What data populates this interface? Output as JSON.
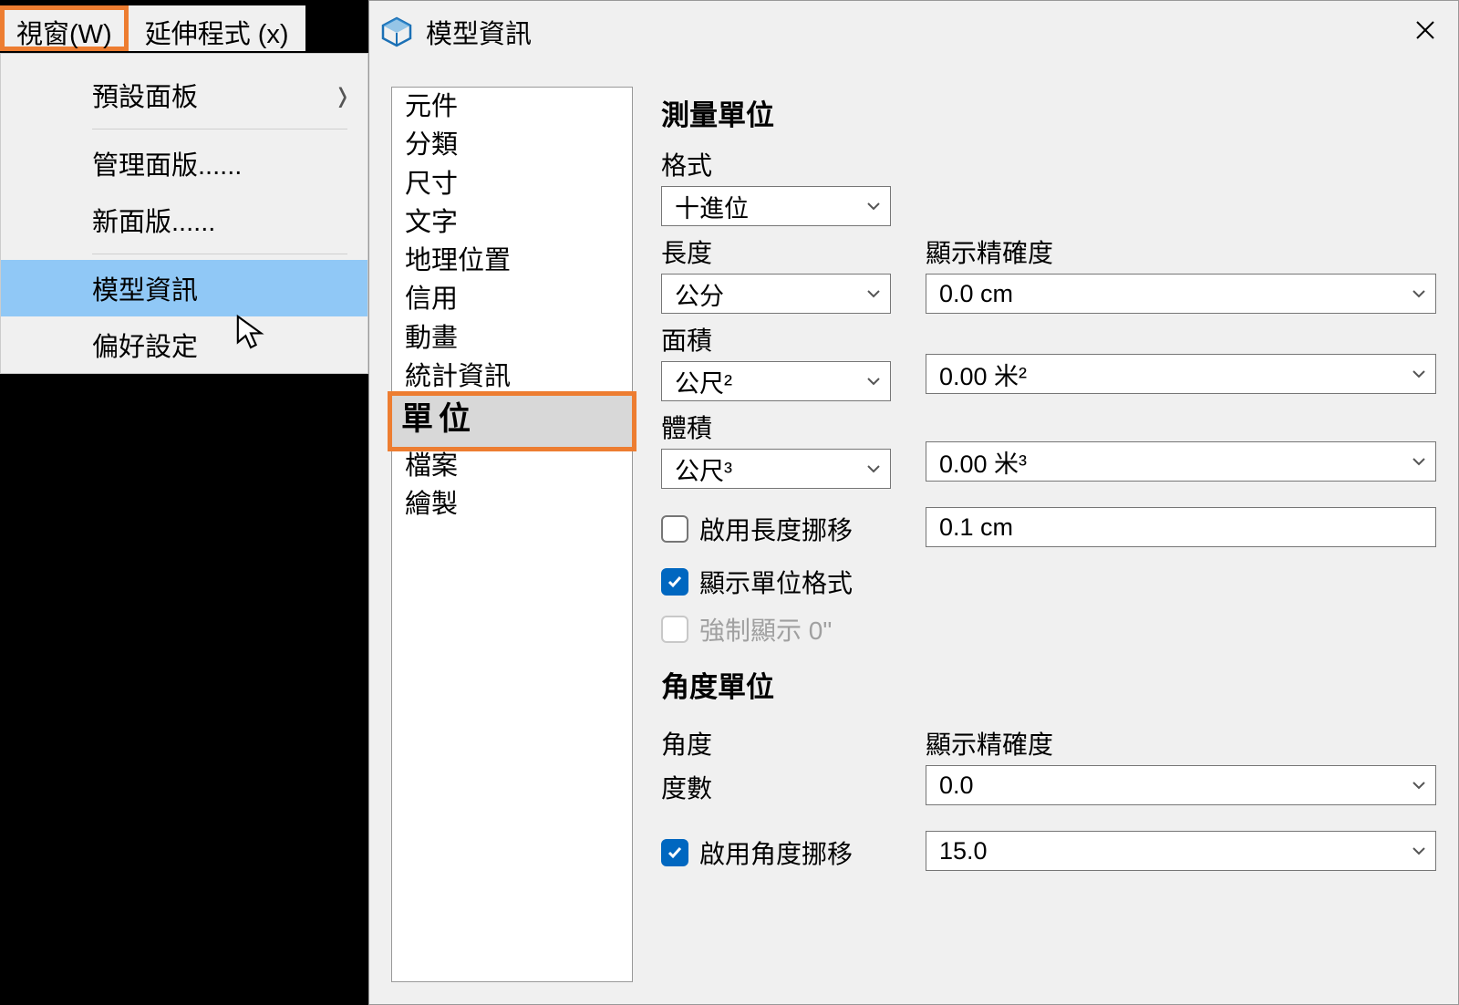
{
  "menubar": {
    "window": "視窗(W)",
    "extensions": "延伸程式 (x)"
  },
  "dropdown": {
    "default_panels": "預設面板",
    "manage_panels": "管理面版......",
    "new_panel": "新面版......",
    "model_info": "模型資訊",
    "preferences": "偏好設定"
  },
  "dialog": {
    "title": "模型資訊"
  },
  "sidebar": {
    "components": "元件",
    "classification": "分類",
    "dimensions": "尺寸",
    "text": "文字",
    "geo": "地理位置",
    "credit": "信用",
    "animation": "動畫",
    "statistics": "統計資訊",
    "units": "單位",
    "file": "檔案",
    "render": "繪製"
  },
  "content": {
    "measurement_units": "測量單位",
    "format": "格式",
    "format_value": "十進位",
    "length": "長度",
    "length_value": "公分",
    "precision": "顯示精確度",
    "precision_length_value": "0.0 cm",
    "area": "面積",
    "area_value": "公尺²",
    "precision_area_value": "0.00 米²",
    "volume": "體積",
    "volume_value": "公尺³",
    "precision_volume_value": "0.00 米³",
    "enable_length_snap": "啟用長度挪移",
    "length_snap_value": "0.1 cm",
    "show_unit_format": "顯示單位格式",
    "force_display": "強制顯示 0\"",
    "angle_units": "角度單位",
    "angle": "角度",
    "degrees": "度數",
    "angle_precision_value": "0.0",
    "enable_angle_snap": "啟用角度挪移",
    "angle_snap_value": "15.0"
  }
}
